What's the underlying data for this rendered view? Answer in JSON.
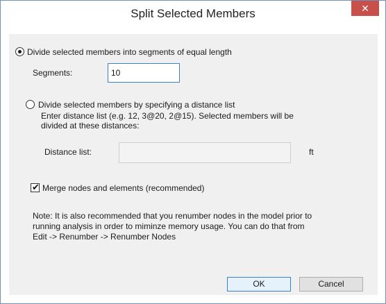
{
  "window": {
    "title": "Split Selected Members",
    "close_label": "✕"
  },
  "options": {
    "equal_length": {
      "label": "Divide selected members into segments of equal length",
      "selected": true,
      "segments_label": "Segments:",
      "segments_value": "10"
    },
    "distance_list": {
      "label": "Divide selected members by specifying a distance list",
      "selected": false,
      "hint_line1": "Enter distance list (e.g. 12, 3@20, 2@15).  Selected members will be",
      "hint_line2": "divided at these distances:",
      "distance_label": "Distance list:",
      "distance_value": "",
      "unit": "ft"
    }
  },
  "merge": {
    "label": "Merge nodes and elements (recommended)",
    "checked": true
  },
  "note": {
    "line1": "Note:  It is also recommended that you renumber nodes in the model prior to",
    "line2": "running analysis in order to miminze memory usage.  You can do that from",
    "line3": "Edit -> Renumber -> Renumber Nodes"
  },
  "buttons": {
    "ok": "OK",
    "cancel": "Cancel"
  },
  "colors": {
    "close_bg": "#c7504a",
    "accent": "#3c7fd1",
    "client_bg": "#f0f0f0"
  }
}
